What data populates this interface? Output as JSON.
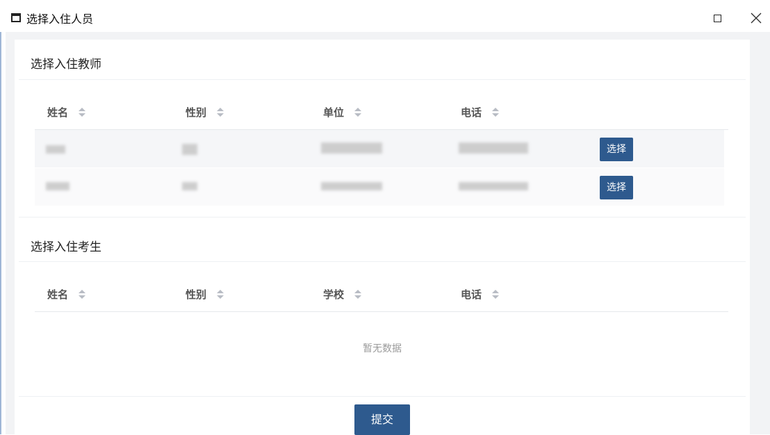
{
  "window": {
    "title": "选择入住人员",
    "icons": {
      "app": "window-icon",
      "maximize": "maximize-icon",
      "close": "close-icon"
    }
  },
  "teachers": {
    "title": "选择入住教师",
    "columns": [
      "姓名",
      "性别",
      "单位",
      "电话"
    ],
    "rows": [
      {
        "action": "选择"
      },
      {
        "action": "选择"
      }
    ]
  },
  "students": {
    "title": "选择入住考生",
    "columns": [
      "姓名",
      "性别",
      "学校",
      "电话"
    ],
    "empty_text": "暂无数据"
  },
  "submit_label": "提交",
  "colors": {
    "primary": "#2e5a8e",
    "background": "#f2f3f5",
    "row_highlight": "#f5f6f8"
  }
}
